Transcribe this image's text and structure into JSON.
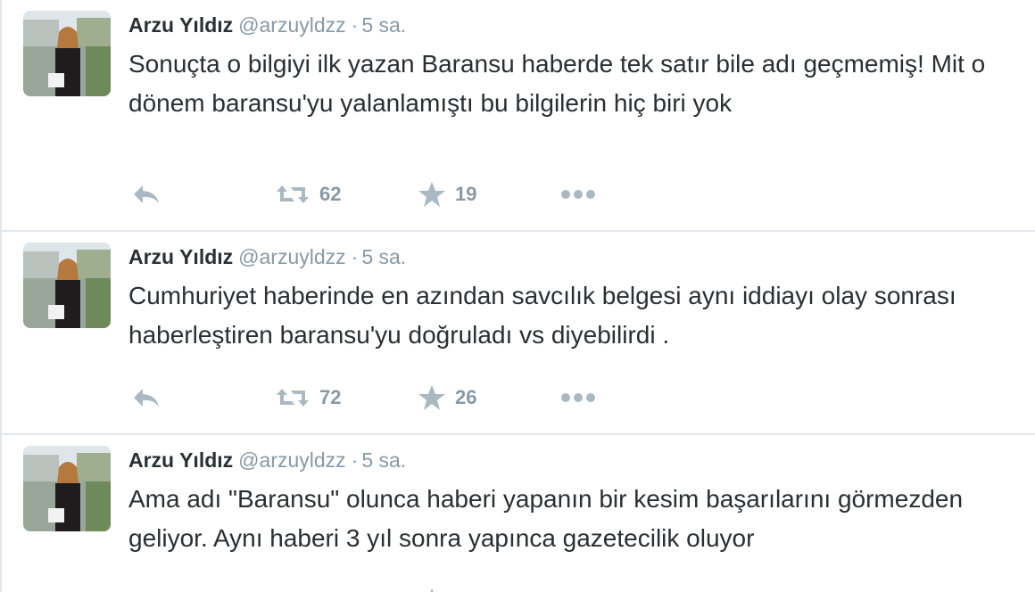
{
  "colors": {
    "text": "#292f33",
    "muted": "#8899a6",
    "icon": "#aab8c2",
    "divider": "#e1e8ed"
  },
  "tweets": [
    {
      "fullname": "Arzu Yıldız",
      "username": "@arzuyldzz",
      "separator": "·",
      "time": "5 sa.",
      "text": "Sonuçta o bilgiyi ilk yazan Baransu haberde tek satır bile adı geçmemiş! Mit o dönem baransu'yu yalanlamıştı bu bilgilerin hiç biri yok",
      "retweets": "62",
      "favorites": "19",
      "icons": [
        "reply-icon",
        "retweet-icon",
        "favorite-star-icon",
        "more-dots-icon"
      ]
    },
    {
      "fullname": "Arzu Yıldız",
      "username": "@arzuyldzz",
      "separator": "·",
      "time": "5 sa.",
      "text": "Cumhuriyet haberinde en azından savcılık belgesi aynı iddiayı olay sonrası haberleştiren baransu'yu doğruladı vs diyebilirdi .",
      "retweets": "72",
      "favorites": "26",
      "icons": [
        "reply-icon",
        "retweet-icon",
        "favorite-star-icon",
        "more-dots-icon"
      ]
    },
    {
      "fullname": "Arzu Yıldız",
      "username": "@arzuyldzz",
      "separator": "·",
      "time": "5 sa.",
      "text": "Ama adı \"Baransu\" olunca haberi yapanın bir kesim başarılarını görmezden geliyor. Aynı haberi 3 yıl sonra yapınca gazetecilik oluyor",
      "retweets": "",
      "favorites": "",
      "icons": [
        "reply-icon",
        "retweet-icon",
        "favorite-star-icon",
        "more-dots-icon"
      ]
    }
  ]
}
